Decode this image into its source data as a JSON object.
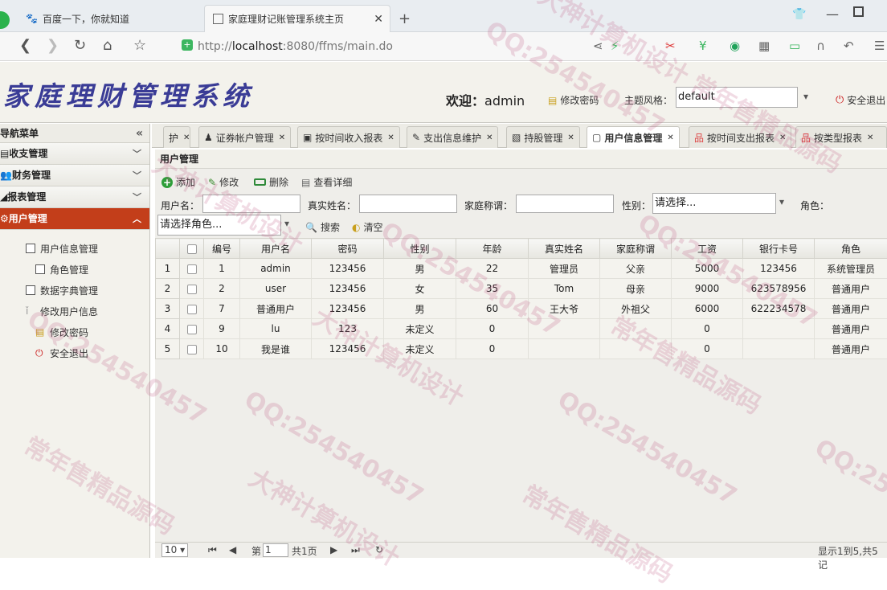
{
  "browser": {
    "tab1": "百度一下，你就知道",
    "tab2": "家庭理财记账管理系统主页",
    "url_prefix": "http://",
    "url_host": "localhost",
    "url_rest": ":8080/ffms/main.do",
    "new_tab": "+"
  },
  "app": {
    "logo": "家庭理财管理系统",
    "welcome_label": "欢迎：",
    "welcome_user": "admin",
    "change_password": "修改密码",
    "theme_label": "主题风格：",
    "theme_value": "default",
    "logout": "安全退出"
  },
  "sidebar": {
    "title": "导航菜单",
    "collapse": "«",
    "sections": [
      "收支管理",
      "财务管理",
      "报表管理",
      "用户管理"
    ],
    "items": [
      "用户信息管理",
      "角色管理",
      "数据字典管理",
      "修改用户信息",
      "修改密码",
      "安全退出"
    ]
  },
  "tabs": [
    {
      "label": "护"
    },
    {
      "label": "证券帐户管理"
    },
    {
      "label": "按时间收入报表"
    },
    {
      "label": "支出信息维护"
    },
    {
      "label": "持股管理"
    },
    {
      "label": "用户信息管理"
    },
    {
      "label": "按时间支出报表"
    },
    {
      "label": "按类型报表"
    }
  ],
  "panel": {
    "title": "用户管理",
    "toolbar": {
      "add": "添加",
      "edit": "修改",
      "delete": "删除",
      "view": "查看详细"
    },
    "filters": {
      "username_label": "用户名：",
      "realname_label": "真实姓名：",
      "family_label": "家庭称谓：",
      "gender_label": "性别：",
      "gender_placeholder": "请选择...",
      "role_label": "角色：",
      "role_placeholder": "请选择角色...",
      "search": "搜索",
      "clear": "清空"
    }
  },
  "grid": {
    "columns": [
      "编号",
      "用户名",
      "密码",
      "性别",
      "年龄",
      "真实姓名",
      "家庭称谓",
      "工资",
      "银行卡号",
      "角色"
    ],
    "rows": [
      [
        "1",
        "admin",
        "123456",
        "男",
        "22",
        "管理员",
        "父亲",
        "5000",
        "123456",
        "系统管理员"
      ],
      [
        "2",
        "user",
        "123456",
        "女",
        "35",
        "Tom",
        "母亲",
        "9000",
        "623578956",
        "普通用户"
      ],
      [
        "7",
        "普通用户",
        "123456",
        "男",
        "60",
        "王大爷",
        "外祖父",
        "6000",
        "622234578",
        "普通用户"
      ],
      [
        "9",
        "lu",
        "123",
        "未定义",
        "0",
        "",
        "",
        "0",
        "",
        "普通用户"
      ],
      [
        "10",
        "我是谁",
        "123456",
        "未定义",
        "0",
        "",
        "",
        "0",
        "",
        "普通用户"
      ]
    ]
  },
  "pager": {
    "page_size": "10",
    "page_label": "第",
    "page_value": "1",
    "total_pages": "共1页",
    "summary": "显示1到5,共5记"
  },
  "watermarks": {
    "qq": "QQ:254540457",
    "design": "大神计算机设计",
    "source": "常年售精品源码"
  }
}
